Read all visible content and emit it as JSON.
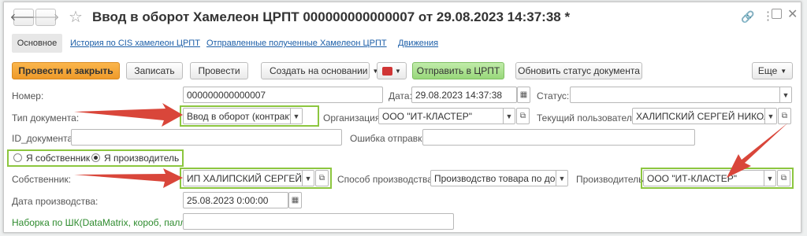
{
  "window": {
    "title": "Ввод в оборот Хамелеон ЦРПТ 000000000000007 от 29.08.2023 14:37:38 *",
    "back_icon": "arrow-left-icon",
    "forward_icon": "arrow-right-icon",
    "favorite_icon": "star-icon",
    "link_icon": "link-icon",
    "more_icon": "vertical-dots-icon",
    "maximize_icon": "maximize-icon",
    "close_icon": "close-icon"
  },
  "tabs": [
    "Основное",
    "История по CIS хамелеон ЦРПТ",
    "Отправленные полученные Хамелеон ЦРПТ",
    "Движения"
  ],
  "toolbar": {
    "post_close": "Провести и закрыть",
    "save": "Записать",
    "post": "Провести",
    "create_based": "Создать на основании",
    "print_icon": "printer-icon",
    "send_crpt": "Отправить в ЦРПТ",
    "update_status": "Обновить статус документа",
    "more": "Еще"
  },
  "fields": {
    "number_label": "Номер:",
    "number_value": "000000000000007",
    "date_label": "Дата:",
    "date_value": "29.08.2023 14:37:38",
    "status_label": "Статус:",
    "status_value": "",
    "doc_type_label": "Тип документа:",
    "doc_type_value": "Ввод в оборот (контракт)",
    "org_label": "Организация:",
    "org_value": "ООО \"ИТ-КЛАСТЕР\"",
    "current_user_label": "Текущий пользователь:",
    "current_user_value": "ХАЛИПСКИЙ СЕРГЕЙ НИКОЛА",
    "doc_id_label": "ID_документа:",
    "doc_id_value": "",
    "send_error_label": "Ошибка отправки:",
    "send_error_value": "",
    "radio_owner": "Я собственник",
    "radio_producer": "Я производитель",
    "owner_label": "Собственник:",
    "owner_value": "ИП ХАЛИПСКИЙ СЕРГЕЙ НИ",
    "prod_method_label": "Способ производства:",
    "prod_method_value": "Производство товара по догов",
    "producer_label": "Производитель:",
    "producer_value": "ООО \"ИТ-КЛАСТЕР\"",
    "prod_date_label": "Дата производства:",
    "prod_date_value": "25.08.2023  0:00:00",
    "barcode_label": "Наборка по ШК(DataMatrix, короб, паллет):",
    "barcode_value": ""
  },
  "colors": {
    "primary_button": "#f5a93a",
    "send_button": "#a8e08a",
    "highlight_box": "#8cc63f",
    "arrow": "#d9463a",
    "link": "#1d5fa8",
    "green_label": "#2e8b2e"
  }
}
